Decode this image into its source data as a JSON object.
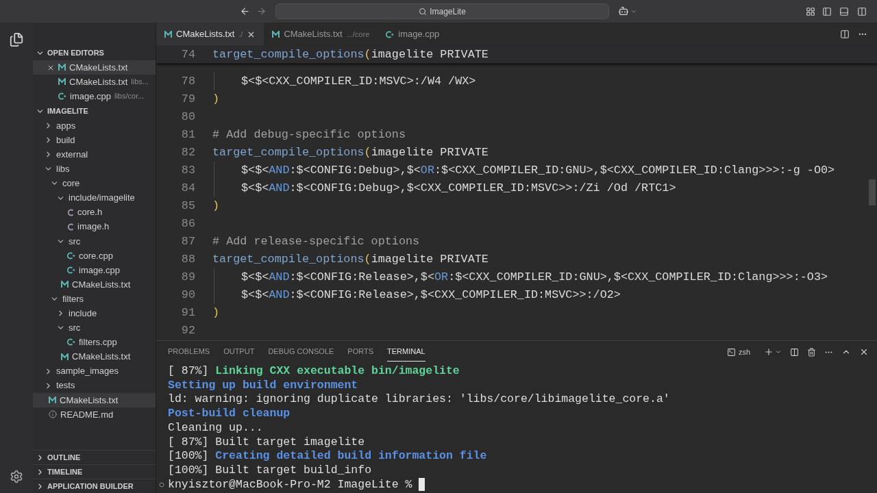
{
  "title_bar": {
    "search": "ImageLite"
  },
  "tabs": [
    {
      "label": "CMakeLists.txt",
      "description": "./",
      "kind": "cmake",
      "selected": true
    },
    {
      "label": "CMakeLists.txt",
      "description": ".../core",
      "kind": "cmake",
      "selected": false
    },
    {
      "label": "image.cpp",
      "kind": "cpp",
      "selected": false
    }
  ],
  "sidebar": {
    "open_editors": {
      "title": "OPEN EDITORS",
      "expanded": true,
      "items": [
        {
          "label": "CMakeLists.txt",
          "kind": "cmake",
          "selected": true
        },
        {
          "label": "CMakeLists.txt",
          "description": "libs...",
          "kind": "cmake",
          "selected": false
        },
        {
          "label": "image.cpp",
          "description": "libs/cor...",
          "kind": "cpp",
          "selected": false
        }
      ]
    },
    "explorer": {
      "title": "IMAGELITE",
      "expanded": true,
      "tree": [
        {
          "label": "apps",
          "kind": "folder",
          "expanded": false,
          "selected": false
        },
        {
          "label": "build",
          "kind": "folder",
          "expanded": false,
          "selected": false
        },
        {
          "label": "external",
          "kind": "folder",
          "expanded": false,
          "selected": false
        },
        {
          "label": "libs",
          "kind": "folder",
          "expanded": true,
          "selected": false,
          "children": [
            {
              "label": "core",
              "kind": "folder",
              "expanded": true,
              "selected": false,
              "children": [
                {
                  "label": "include/imagelite",
                  "kind": "folder",
                  "expanded": true,
                  "selected": false,
                  "children": [
                    {
                      "label": "core.h",
                      "kind": "header",
                      "selected": false
                    },
                    {
                      "label": "image.h",
                      "kind": "header",
                      "selected": false
                    }
                  ]
                },
                {
                  "label": "src",
                  "kind": "folder",
                  "expanded": true,
                  "selected": false,
                  "children": [
                    {
                      "label": "core.cpp",
                      "kind": "cpp",
                      "selected": false
                    },
                    {
                      "label": "image.cpp",
                      "kind": "cpp",
                      "selected": false
                    }
                  ]
                },
                {
                  "label": "CMakeLists.txt",
                  "kind": "cmake",
                  "selected": false
                }
              ]
            },
            {
              "label": "filters",
              "kind": "folder",
              "expanded": true,
              "selected": false,
              "children": [
                {
                  "label": "include",
                  "kind": "folder",
                  "expanded": false,
                  "selected": false
                },
                {
                  "label": "src",
                  "kind": "folder",
                  "expanded": true,
                  "selected": false,
                  "children": [
                    {
                      "label": "filters.cpp",
                      "kind": "cpp",
                      "selected": false
                    }
                  ]
                },
                {
                  "label": "CMakeLists.txt",
                  "kind": "cmake",
                  "selected": false
                }
              ]
            }
          ]
        },
        {
          "label": "sample_images",
          "kind": "folder",
          "expanded": false,
          "selected": false
        },
        {
          "label": "tests",
          "kind": "folder",
          "expanded": false,
          "selected": false
        },
        {
          "label": "CMakeLists.txt",
          "kind": "cmake",
          "selected": true
        },
        {
          "label": "README.md",
          "kind": "info",
          "selected": false
        }
      ]
    },
    "sections": [
      {
        "title": "OUTLINE",
        "expanded": false
      },
      {
        "title": "TIMELINE",
        "expanded": false
      },
      {
        "title": "APPLICATION BUILDER",
        "expanded": false
      }
    ]
  },
  "editor": {
    "sticky_line": {
      "number": "74",
      "tokens": [
        {
          "kind": "function",
          "text": "target_compile_options"
        },
        {
          "kind": "paren",
          "text": "("
        },
        {
          "kind": "plain",
          "text": "imagelite PRIVATE"
        }
      ]
    },
    "lines": [
      {
        "number": "78",
        "indent": true,
        "tokens": [
          {
            "kind": "plain",
            "text": "$<$<CXX_COMPILER_ID:MSVC>:/W4 /WX>"
          }
        ]
      },
      {
        "number": "79",
        "indent": false,
        "tokens": [
          {
            "kind": "paren",
            "text": ")"
          }
        ]
      },
      {
        "number": "80",
        "indent": false
      },
      {
        "number": "81",
        "indent": false,
        "tokens": [
          {
            "kind": "comment",
            "text": "# Add debug-specific options"
          }
        ]
      },
      {
        "number": "82",
        "indent": false,
        "tokens": [
          {
            "kind": "function",
            "text": "target_compile_options"
          },
          {
            "kind": "paren",
            "text": "("
          },
          {
            "kind": "plain",
            "text": "imagelite PRIVATE"
          }
        ]
      },
      {
        "number": "83",
        "indent": true,
        "tokens": [
          {
            "kind": "plain",
            "text": "$<$<"
          },
          {
            "kind": "keyword",
            "text": "AND"
          },
          {
            "kind": "plain",
            "text": ":$<CONFIG:Debug>,$<"
          },
          {
            "kind": "keyword",
            "text": "OR"
          },
          {
            "kind": "plain",
            "text": ":$<CXX_COMPILER_ID:GNU>,$<CXX_COMPILER_ID:Clang>>>:-g -O0>"
          }
        ]
      },
      {
        "number": "84",
        "indent": true,
        "tokens": [
          {
            "kind": "plain",
            "text": "$<$<"
          },
          {
            "kind": "keyword",
            "text": "AND"
          },
          {
            "kind": "plain",
            "text": ":$<CONFIG:Debug>,$<CXX_COMPILER_ID:MSVC>>:/Zi /Od /RTC1>"
          }
        ]
      },
      {
        "number": "85",
        "indent": false,
        "tokens": [
          {
            "kind": "paren",
            "text": ")"
          }
        ]
      },
      {
        "number": "86",
        "indent": false
      },
      {
        "number": "87",
        "indent": false,
        "tokens": [
          {
            "kind": "comment",
            "text": "# Add release-specific options"
          }
        ]
      },
      {
        "number": "88",
        "indent": false,
        "tokens": [
          {
            "kind": "function",
            "text": "target_compile_options"
          },
          {
            "kind": "paren",
            "text": "("
          },
          {
            "kind": "plain",
            "text": "imagelite PRIVATE"
          }
        ]
      },
      {
        "number": "89",
        "indent": true,
        "tokens": [
          {
            "kind": "plain",
            "text": "$<$<"
          },
          {
            "kind": "keyword",
            "text": "AND"
          },
          {
            "kind": "plain",
            "text": ":$<CONFIG:Release>,$<"
          },
          {
            "kind": "keyword",
            "text": "OR"
          },
          {
            "kind": "plain",
            "text": ":$<CXX_COMPILER_ID:GNU>,$<CXX_COMPILER_ID:Clang>>>:-O3>"
          }
        ]
      },
      {
        "number": "90",
        "indent": true,
        "tokens": [
          {
            "kind": "plain",
            "text": "$<$<"
          },
          {
            "kind": "keyword",
            "text": "AND"
          },
          {
            "kind": "plain",
            "text": ":$<CONFIG:Release>,$<CXX_COMPILER_ID:MSVC>>:/O2>"
          }
        ]
      },
      {
        "number": "91",
        "indent": false,
        "tokens": [
          {
            "kind": "paren",
            "text": ")"
          }
        ]
      },
      {
        "number": "92",
        "indent": false
      }
    ]
  },
  "panel": {
    "tabs": [
      {
        "label": "PROBLEMS",
        "selected": false
      },
      {
        "label": "OUTPUT",
        "selected": false
      },
      {
        "label": "DEBUG CONSOLE",
        "selected": false
      },
      {
        "label": "PORTS",
        "selected": false
      },
      {
        "label": "TERMINAL",
        "selected": true
      }
    ],
    "shell": "zsh",
    "lines": [
      {
        "tokens": [
          {
            "kind": "plain",
            "text": "[ 87%] "
          },
          {
            "kind": "success",
            "text": "Linking CXX executable bin/imagelite"
          }
        ]
      },
      {
        "tokens": [
          {
            "kind": "info",
            "text": "Setting up build environment"
          }
        ]
      },
      {
        "tokens": [
          {
            "kind": "plain",
            "text": "ld: warning: ignoring duplicate libraries: 'libs/core/libimagelite_core.a'"
          }
        ]
      },
      {
        "tokens": [
          {
            "kind": "info",
            "text": "Post-build cleanup"
          }
        ]
      },
      {
        "tokens": [
          {
            "kind": "plain",
            "text": "Cleaning up..."
          }
        ]
      },
      {
        "tokens": [
          {
            "kind": "plain",
            "text": "[ 87%] Built target imagelite"
          }
        ]
      },
      {
        "tokens": [
          {
            "kind": "plain",
            "text": "[100%] "
          },
          {
            "kind": "info",
            "text": "Creating detailed build information file"
          }
        ]
      },
      {
        "tokens": [
          {
            "kind": "plain",
            "text": "[100%] Built target build_info"
          }
        ]
      }
    ],
    "prompt": "knyisztor@MacBook-Pro-M2 ImageLite %"
  }
}
